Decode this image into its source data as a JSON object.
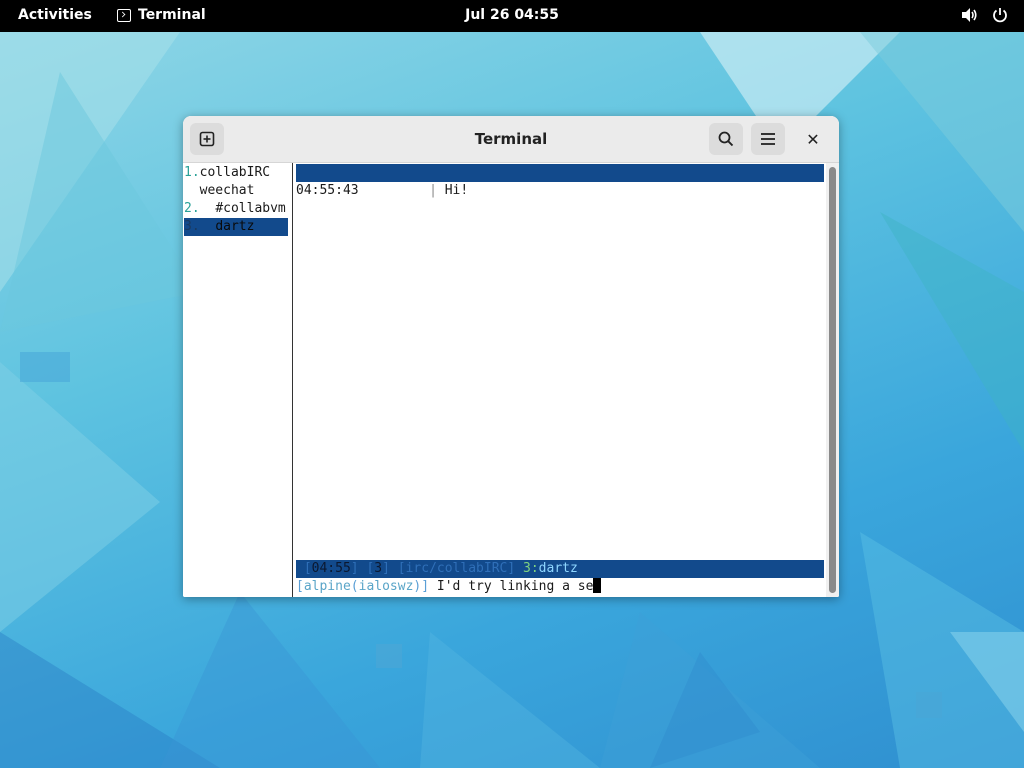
{
  "topbar": {
    "activities_label": "Activities",
    "app_name": "Terminal",
    "clock": "Jul 26  04:55",
    "volume_icon": "speaker-icon",
    "power_icon": "power-icon"
  },
  "window": {
    "title": "Terminal",
    "new_tab_icon": "plus-square-icon",
    "search_icon": "search-icon",
    "menu_icon": "hamburger-icon",
    "close_label": "✕"
  },
  "buflist": [
    {
      "num": "1.",
      "text": "collabIRC",
      "selected": false
    },
    {
      "num": "",
      "text": "weechat",
      "selected": false
    },
    {
      "num": "2.",
      "text": "#collabvm",
      "selected": false
    },
    {
      "num": "3.",
      "text": "dartz",
      "selected": true
    }
  ],
  "chat": {
    "lines": [
      {
        "time": "04:55:43",
        "nick": "",
        "message": "Hi!"
      }
    ]
  },
  "status_bar": {
    "time": "04:55",
    "buffer_num": "3",
    "server_prefix": "irc",
    "server_name": "collabIRC",
    "buffer_index": "3",
    "buffer_name": "dartz"
  },
  "input": {
    "host": "alpine",
    "nick": "ialoswz",
    "text": "I'd try linking a se"
  },
  "colors": {
    "accent": "#124a8c",
    "topbar": "#000000",
    "headerbar": "#ebebeb"
  }
}
